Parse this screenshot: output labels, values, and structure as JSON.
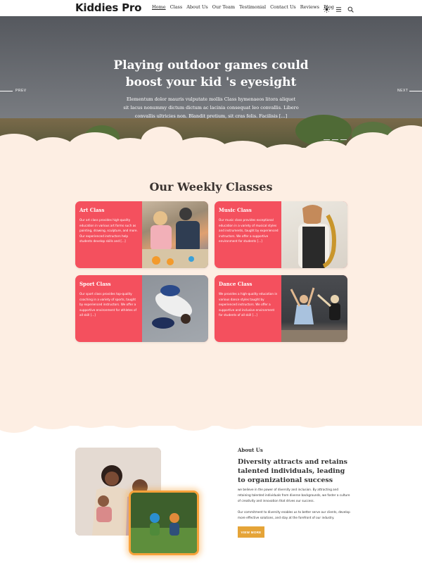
{
  "brand": {
    "logo": "Kiddies Pro"
  },
  "nav": {
    "items": [
      "Home",
      "Class",
      "About Us",
      "Our Team",
      "Testimonial",
      "Contact Us",
      "Reviews",
      "Blog"
    ],
    "active": "Home"
  },
  "header_icons": [
    "sun-icon",
    "menu-icon",
    "search-icon"
  ],
  "hero": {
    "title": "Playing outdoor games could boost your kid 's eyesight",
    "text": "Elementum dolor mauris vulputate mollis Class hymenaeos litora aliquet sit lacus nonummy dictum dictum ac lacinia consequat leo convallis. Libero convallis ultricies non. Blandit pretium, sit cras felis. Facilisis [...]",
    "prev_label": "PREV",
    "next_label": "NEXT"
  },
  "classes": {
    "title": "Our Weekly Classes",
    "cards": [
      {
        "title": "Art Class",
        "text": "Our art class provides high-quality education in various art forms such as painting, drawing, sculpture, and more. Our experienced instructors help students develop skills and [...]"
      },
      {
        "title": "Music Class",
        "text": "Our music class provides exceptional education in a variety of musical styles and instruments, taught by experienced instructors. We offer a supportive environment for students [...]"
      },
      {
        "title": "Sport Class",
        "text": "Our sport class provides top-quality coaching in a variety of sports, taught by experienced instructors. We offer a supportive environment for athletes of all skill [...]"
      },
      {
        "title": "Dance Class",
        "text": "We provides a high-quality education in various dance styles taught by experienced instructors. We offer a supportive and inclusive environment for students of all skill [...]"
      }
    ]
  },
  "about": {
    "label": "About Us",
    "title": "Diversity attracts and retains talented individuals, leading to organizational success",
    "p1": "we believe in the power of diversity and inclusion. By attracting and retaining talented individuals from diverse backgrounds, we foster a culture of creativity and innovation that drives our success.",
    "p2": "Our commitment to diversity enables us to better serve our clients, develop more effective solutions, and stay at the forefront of our industry.",
    "button": "VIEW MORE"
  },
  "colors": {
    "card": "#f4505e",
    "cream": "#fdeee3",
    "button": "#e5a438",
    "accent_border": "#f7a23a"
  }
}
